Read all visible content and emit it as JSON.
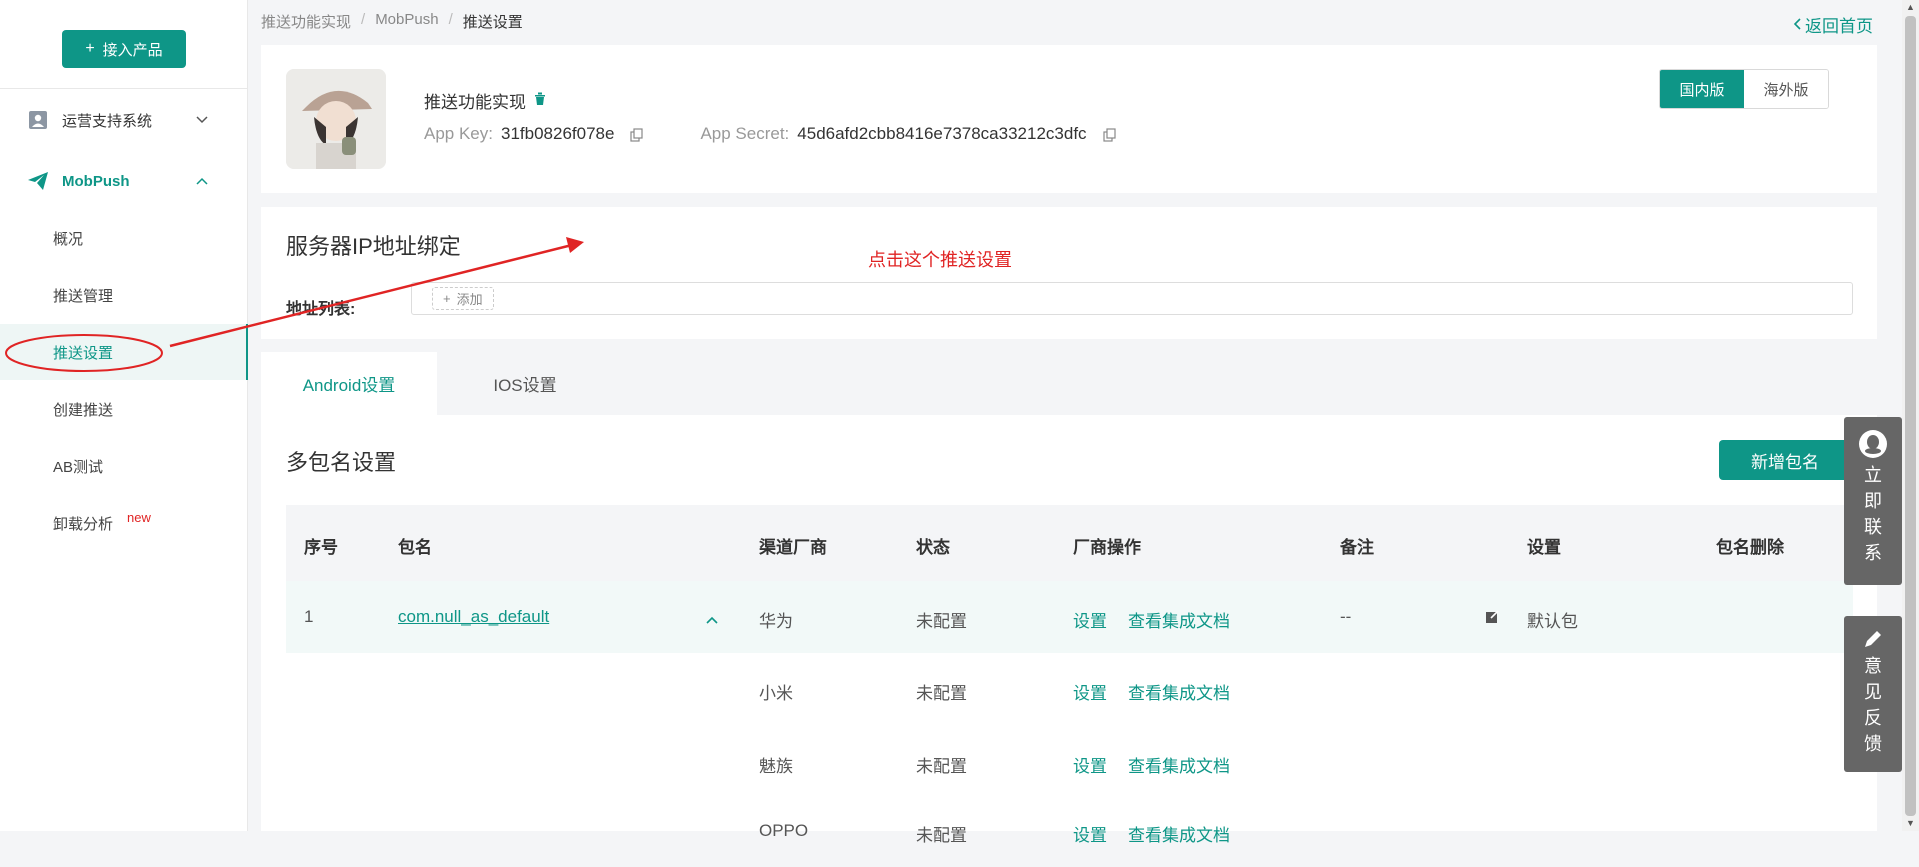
{
  "sidebar": {
    "add_product": "接入产品",
    "groups": [
      {
        "label": "运营支持系统",
        "icon": "user-icon",
        "expanded": false
      },
      {
        "label": "MobPush",
        "icon": "paper-plane-icon",
        "expanded": true
      }
    ],
    "items": [
      {
        "label": "概况"
      },
      {
        "label": "推送管理"
      },
      {
        "label": "推送设置",
        "active": true
      },
      {
        "label": "创建推送"
      },
      {
        "label": "AB测试"
      },
      {
        "label": "卸载分析",
        "badge": "new"
      }
    ]
  },
  "breadcrumb": [
    "推送功能实现",
    "MobPush",
    "推送设置"
  ],
  "back_home": "返回首页",
  "app": {
    "name": "推送功能实现",
    "app_key_label": "App Key:",
    "app_key": "31fb0826f078e",
    "app_secret_label": "App Secret:",
    "app_secret": "45d6afd2cbb8416e7378ca33212c3dfc"
  },
  "version": {
    "domestic": "国内版",
    "overseas": "海外版",
    "selected": "国内版"
  },
  "ip_binding": {
    "title": "服务器IP地址绑定",
    "list_label": "地址列表:",
    "add_label": "添加"
  },
  "annotation": {
    "text": "点击这个推送设置",
    "color": "#e02424"
  },
  "tabs": [
    {
      "label": "Android设置",
      "active": true
    },
    {
      "label": "IOS设置",
      "active": false
    }
  ],
  "package": {
    "title": "多包名设置",
    "new_button": "新增包名",
    "columns": [
      "序号",
      "包名",
      "渠道厂商",
      "状态",
      "厂商操作",
      "备注",
      "设置",
      "包名删除"
    ],
    "row": {
      "index": "1",
      "name": "com.null_as_default",
      "remark": "--",
      "setting": "默认包"
    },
    "vendors": [
      {
        "vendor": "华为",
        "status": "未配置",
        "op1": "设置",
        "op2": "查看集成文档"
      },
      {
        "vendor": "小米",
        "status": "未配置",
        "op1": "设置",
        "op2": "查看集成文档"
      },
      {
        "vendor": "魅族",
        "status": "未配置",
        "op1": "设置",
        "op2": "查看集成文档"
      },
      {
        "vendor": "OPPO",
        "status": "未配置",
        "op1": "设置",
        "op2": "查看集成文档"
      }
    ]
  },
  "float_contact": [
    "立",
    "即",
    "联",
    "系"
  ],
  "float_feedback": [
    "意",
    "见",
    "反",
    "馈"
  ],
  "colors": {
    "accent": "#0e9687",
    "annotation": "#e02424"
  }
}
